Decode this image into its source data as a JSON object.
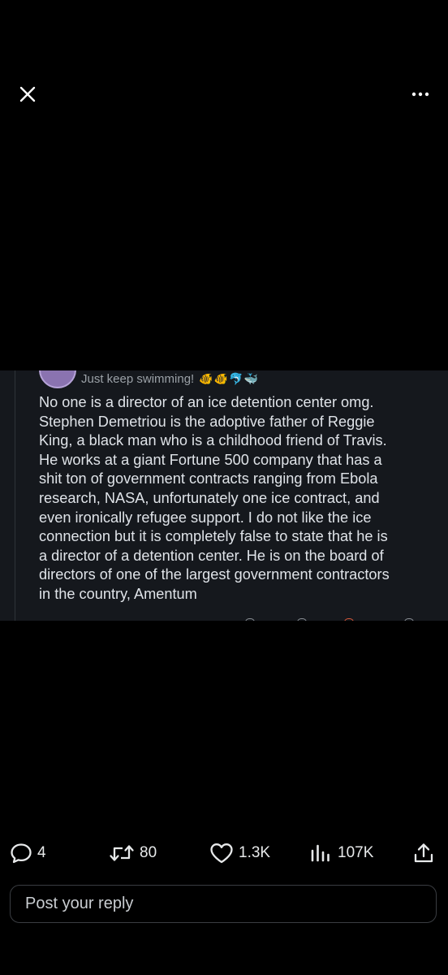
{
  "top_bar": {
    "close_icon": "close-icon",
    "more_icon": "more-horizontal-icon"
  },
  "media": {
    "username": "Just keep swimming!",
    "emojis": [
      "🐠",
      "🐠",
      "🐬",
      "🐳"
    ],
    "body": "No one is a director of an ice detention center omg.\nStephen Demetriou is the adoptive father of Reggie\nKing, a black man who is a childhood friend of Travis.\nHe works at a giant Fortune 500 company that has a\nshit ton of government contracts ranging from Ebola\nresearch, NASA, unfortunately one ice contract, and\neven ironically refugee support. I do not like the ice\nconnection but it is completely false to state that he is\na director of a detention center. He is on the board of\ndirectors of one of the largest government contractors\nin the country, Amentum"
  },
  "actions": {
    "reply_count": "4",
    "repost_count": "80",
    "like_count": "1.3K",
    "view_count": "107K"
  },
  "reply_box": {
    "placeholder": "Post your reply"
  },
  "colors": {
    "background": "#000000",
    "text": "#e7e9ea",
    "media_bg": "#15181d"
  }
}
